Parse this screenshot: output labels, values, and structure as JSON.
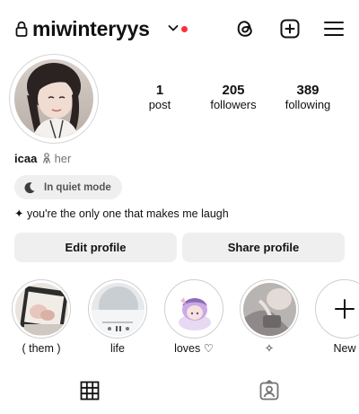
{
  "header": {
    "username": "miwinteryys",
    "has_notification_dot": true,
    "accent_dot_color": "#ff2e3b",
    "icons": [
      "lock-icon",
      "chevron-down-icon",
      "threads-icon",
      "create-plus-icon",
      "menu-icon"
    ]
  },
  "stats": {
    "posts_count": "1",
    "posts_label": "post",
    "followers_count": "205",
    "followers_label": "followers",
    "following_count": "389",
    "following_label": "following"
  },
  "profile": {
    "name": "icaa",
    "pronoun_icon": "person-icon",
    "pronouns": "her",
    "status_icon": "moon-icon",
    "status": "In quiet mode",
    "bio": "✦ you're the only one that makes me laugh"
  },
  "actions": {
    "edit_label": "Edit profile",
    "share_label": "Share profile"
  },
  "highlights": [
    {
      "label": "( them )"
    },
    {
      "label": "life"
    },
    {
      "label": "loves ♡"
    },
    {
      "label": "✧"
    },
    {
      "label": "New"
    }
  ],
  "tabs": [
    "grid-icon",
    "tagged-icon"
  ]
}
